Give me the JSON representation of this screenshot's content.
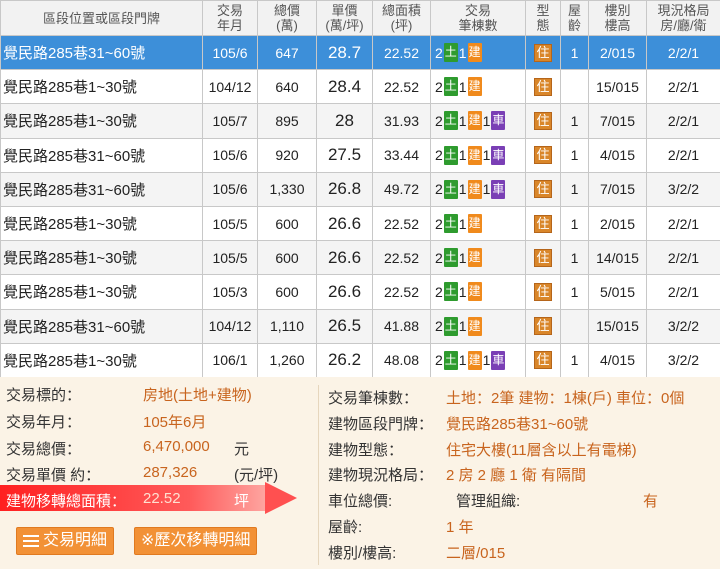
{
  "headers": {
    "addr": "區段位置或區段門牌",
    "date1": "交易",
    "date2": "年月",
    "total1": "總價",
    "total2": "(萬)",
    "unit1": "單價",
    "unit2": "(萬/坪)",
    "area1": "總面積",
    "area2": "(坪)",
    "count1": "交易",
    "count2": "筆棟數",
    "type1": "型",
    "type2": "態",
    "age1": "屋",
    "age2": "齡",
    "floor1": "樓別",
    "floor2": "樓高",
    "layout1": "現況格局",
    "layout2": "房/廳/衛"
  },
  "tags": {
    "land": "土",
    "building": "建",
    "car": "車",
    "type": "住"
  },
  "rows": [
    {
      "addr": "覺民路285巷31~60號",
      "date": "105/6",
      "total": "647",
      "unit": "28.7",
      "area": "22.52",
      "land": "2",
      "bld": "1",
      "car": "",
      "age": "1",
      "floor": "2/015",
      "layout": "2/2/1"
    },
    {
      "addr": "覺民路285巷1~30號",
      "date": "104/12",
      "total": "640",
      "unit": "28.4",
      "area": "22.52",
      "land": "2",
      "bld": "1",
      "car": "",
      "age": "",
      "floor": "15/015",
      "layout": "2/2/1"
    },
    {
      "addr": "覺民路285巷1~30號",
      "date": "105/7",
      "total": "895",
      "unit": "28",
      "area": "31.93",
      "land": "2",
      "bld": "1",
      "car": "1",
      "age": "1",
      "floor": "7/015",
      "layout": "2/2/1"
    },
    {
      "addr": "覺民路285巷31~60號",
      "date": "105/6",
      "total": "920",
      "unit": "27.5",
      "area": "33.44",
      "land": "2",
      "bld": "1",
      "car": "1",
      "age": "1",
      "floor": "4/015",
      "layout": "2/2/1"
    },
    {
      "addr": "覺民路285巷31~60號",
      "date": "105/6",
      "total": "1,330",
      "unit": "26.8",
      "area": "49.72",
      "land": "2",
      "bld": "1",
      "car": "1",
      "age": "1",
      "floor": "7/015",
      "layout": "3/2/2"
    },
    {
      "addr": "覺民路285巷1~30號",
      "date": "105/5",
      "total": "600",
      "unit": "26.6",
      "area": "22.52",
      "land": "2",
      "bld": "1",
      "car": "",
      "age": "1",
      "floor": "2/015",
      "layout": "2/2/1"
    },
    {
      "addr": "覺民路285巷1~30號",
      "date": "105/5",
      "total": "600",
      "unit": "26.6",
      "area": "22.52",
      "land": "2",
      "bld": "1",
      "car": "",
      "age": "1",
      "floor": "14/015",
      "layout": "2/2/1"
    },
    {
      "addr": "覺民路285巷1~30號",
      "date": "105/3",
      "total": "600",
      "unit": "26.6",
      "area": "22.52",
      "land": "2",
      "bld": "1",
      "car": "",
      "age": "1",
      "floor": "5/015",
      "layout": "2/2/1"
    },
    {
      "addr": "覺民路285巷31~60號",
      "date": "104/12",
      "total": "1,110",
      "unit": "26.5",
      "area": "41.88",
      "land": "2",
      "bld": "1",
      "car": "",
      "age": "",
      "floor": "15/015",
      "layout": "3/2/2"
    },
    {
      "addr": "覺民路285巷1~30號",
      "date": "106/1",
      "total": "1,260",
      "unit": "26.2",
      "area": "48.08",
      "land": "2",
      "bld": "1",
      "car": "1",
      "age": "1",
      "floor": "4/015",
      "layout": "3/2/2"
    }
  ],
  "detail": {
    "target_label": "交易標的：",
    "target_value": "房地(土地+建物)",
    "ym_label": "交易年月：",
    "ym_value": "105年6月",
    "total_label": "交易總價：",
    "total_value": "6,470,000",
    "total_unit": "元",
    "unitprice_label": "交易單價 約：",
    "unitprice_value": "287,326",
    "unitprice_unit": "(元/坪)",
    "area_label": "建物移轉總面積：",
    "area_value": "22.52",
    "area_unit": "坪",
    "count_label": "交易筆棟數：",
    "count_value": "土地：2筆 建物：1棟(戶) 車位：0個",
    "addr_label": "建物區段門牌：",
    "addr_value": "覺民路285巷31~60號",
    "btype_label": "建物型態：",
    "btype_value": "住宅大樓(11層含以上有電梯)",
    "layout_label": "建物現況格局：",
    "layout_value": "2 房 2 廳 1 衛 有隔間",
    "parking_label": "車位總價:",
    "mgmt_label": "管理組織:",
    "mgmt_value": "有",
    "age_label": "屋齡:",
    "age_value": "1 年",
    "floor_label": "樓別/樓高:",
    "floor_value": "二層/015",
    "btn_detail": "交易明細",
    "btn_history": "※歷次移轉明細"
  },
  "colors": {
    "selected_row": "#3d8fd9",
    "accent": "#f29136",
    "land_tag": "#2e9b2e",
    "building_tag": "#f08a1c",
    "car_tag": "#7a3fb5"
  }
}
